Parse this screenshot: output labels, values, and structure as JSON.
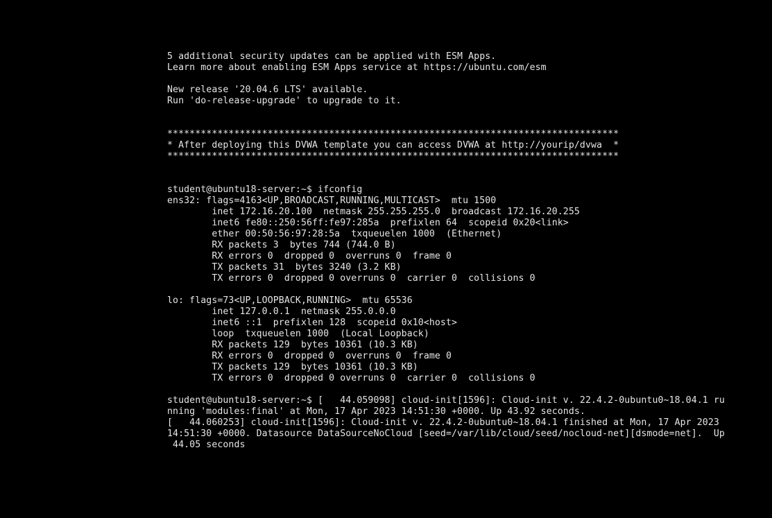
{
  "console": {
    "motd": {
      "esm_updates": "5 additional security updates can be applied with ESM Apps.",
      "esm_learn": "Learn more about enabling ESM Apps service at https://ubuntu.com/esm",
      "release_available": "New release '20.04.6 LTS' available.",
      "release_upgrade": "Run 'do-release-upgrade' to upgrade to it."
    },
    "banner": {
      "top": "*********************************************************************************",
      "message": "* After deploying this DVWA template you can access DVWA at http://yourip/dvwa  *",
      "bottom": "*********************************************************************************"
    },
    "prompt1": "student@ubuntu18-server:~$ ifconfig",
    "ens32": {
      "header": "ens32: flags=4163<UP,BROADCAST,RUNNING,MULTICAST>  mtu 1500",
      "inet": "        inet 172.16.20.100  netmask 255.255.255.0  broadcast 172.16.20.255",
      "inet6": "        inet6 fe80::250:56ff:fe97:285a  prefixlen 64  scopeid 0x20<link>",
      "ether": "        ether 00:50:56:97:28:5a  txqueuelen 1000  (Ethernet)",
      "rx_packets": "        RX packets 3  bytes 744 (744.0 B)",
      "rx_errors": "        RX errors 0  dropped 0  overruns 0  frame 0",
      "tx_packets": "        TX packets 31  bytes 3240 (3.2 KB)",
      "tx_errors": "        TX errors 0  dropped 0 overruns 0  carrier 0  collisions 0"
    },
    "lo": {
      "header": "lo: flags=73<UP,LOOPBACK,RUNNING>  mtu 65536",
      "inet": "        inet 127.0.0.1  netmask 255.0.0.0",
      "inet6": "        inet6 ::1  prefixlen 128  scopeid 0x10<host>",
      "loop": "        loop  txqueuelen 1000  (Local Loopback)",
      "rx_packets": "        RX packets 129  bytes 10361 (10.3 KB)",
      "rx_errors": "        RX errors 0  dropped 0  overruns 0  frame 0",
      "tx_packets": "        TX packets 129  bytes 10361 (10.3 KB)",
      "tx_errors": "        TX errors 0  dropped 0 overruns 0  carrier 0  collisions 0"
    },
    "cloud_init": {
      "line1": "student@ubuntu18-server:~$ [   44.059098] cloud-init[1596]: Cloud-init v. 22.4.2-0ubuntu0~18.04.1 ru",
      "line2": "nning 'modules:final' at Mon, 17 Apr 2023 14:51:30 +0000. Up 43.92 seconds.",
      "line3": "[   44.060253] cloud-init[1596]: Cloud-init v. 22.4.2-0ubuntu0~18.04.1 finished at Mon, 17 Apr 2023",
      "line4": "14:51:30 +0000. Datasource DataSourceNoCloud [seed=/var/lib/cloud/seed/nocloud-net][dsmode=net].  Up",
      "line5": " 44.05 seconds"
    }
  }
}
